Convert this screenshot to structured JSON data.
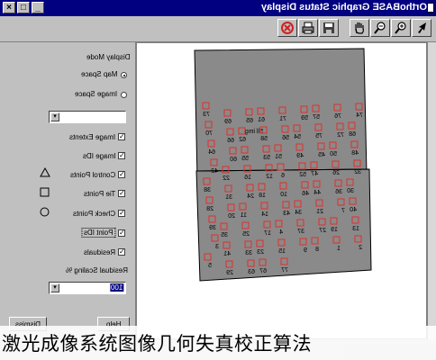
{
  "window": {
    "title": "OrthoBASE Graphic Status Display",
    "min_icon": "minimize-icon",
    "max_icon": "maximize-icon",
    "close_icon": "close-icon"
  },
  "toolbar": {
    "icons": [
      "cursor-arrow-icon",
      "zoom-out-icon",
      "zoom-in-icon",
      "pan-hand-icon",
      "save-icon",
      "print-icon",
      "close-red-icon"
    ]
  },
  "panel": {
    "display_mode_label": "Display Mode",
    "map_space_label": "Map Space",
    "image_space_label": "Image Space",
    "image_extents_label": "Image Extents",
    "image_ids_label": "Image IDs",
    "control_points_label": "Control Points",
    "tie_points_label": "Tie Points",
    "check_points_label": "Check Points",
    "point_ids_label": "Point IDs",
    "residuals_label": "Residuals",
    "residual_scaling_label": "Residual Scaling %",
    "residual_scaling_value": "100",
    "help_button": "Help",
    "dismiss_button": "Dismiss"
  },
  "image": {
    "upper_image_label": "5ll img",
    "point_ids": [
      "73",
      "69",
      "65",
      "61",
      "71",
      "59",
      "57",
      "76",
      "74",
      "70",
      "66",
      "62",
      "58",
      "56",
      "54",
      "75",
      "72",
      "68",
      "64",
      "60",
      "55",
      "53",
      "51",
      "49",
      "45",
      "50",
      "48",
      "42",
      "22",
      "16",
      "12",
      "6",
      "52",
      "47",
      "26",
      "32",
      "38",
      "31",
      "24",
      "18",
      "10",
      "46",
      "44",
      "36",
      "30",
      "28",
      "20",
      "11",
      "14",
      "43",
      "34",
      "21",
      "7",
      "40",
      "39",
      "35",
      "25",
      "17",
      "4",
      "37",
      "27",
      "19",
      "13",
      "3",
      "41",
      "33",
      "23",
      "15",
      "9",
      "8",
      "1",
      "2",
      "5",
      "29",
      "63",
      "67",
      "77"
    ],
    "marker_color": "#e0302a"
  },
  "caption": "激光成像系统图像几何失真校正算法"
}
